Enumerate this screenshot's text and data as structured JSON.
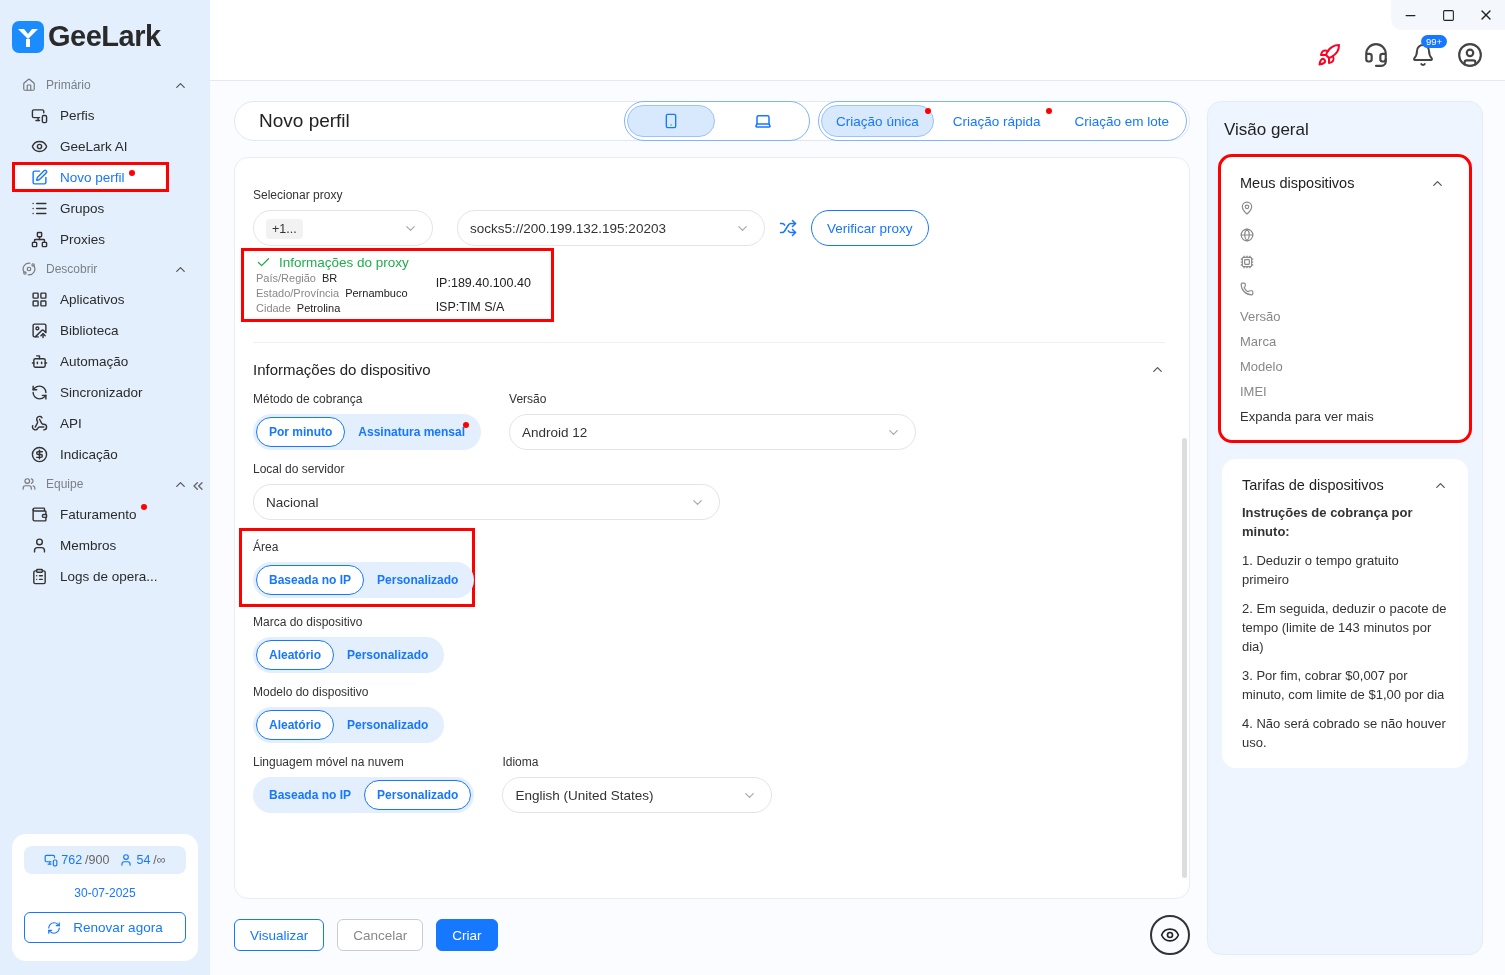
{
  "logo": {
    "text": "GeeLark"
  },
  "sidebar": {
    "sections": [
      {
        "title": "Primário",
        "kind": "home",
        "expanded": true,
        "items": [
          {
            "label": "Perfis",
            "kind": "profiles",
            "selected": false,
            "dot": false,
            "highlighted": false
          },
          {
            "label": "GeeLark AI",
            "kind": "ai",
            "selected": false,
            "dot": false,
            "highlighted": false
          },
          {
            "label": "Novo perfil",
            "kind": "new",
            "selected": true,
            "dot": true,
            "highlighted": true
          },
          {
            "label": "Grupos",
            "kind": "groups",
            "selected": false,
            "dot": false,
            "highlighted": false
          },
          {
            "label": "Proxies",
            "kind": "proxies",
            "selected": false,
            "dot": false,
            "highlighted": false
          }
        ]
      },
      {
        "title": "Descobrir",
        "kind": "discover",
        "expanded": true,
        "items": [
          {
            "label": "Aplicativos",
            "kind": "apps",
            "selected": false,
            "dot": false,
            "highlighted": false
          },
          {
            "label": "Biblioteca",
            "kind": "library",
            "selected": false,
            "dot": false,
            "highlighted": false
          },
          {
            "label": "Automação",
            "kind": "automation",
            "selected": false,
            "dot": false,
            "highlighted": false
          },
          {
            "label": "Sincronizador",
            "kind": "sync",
            "selected": false,
            "dot": false,
            "highlighted": false
          },
          {
            "label": "API",
            "kind": "api",
            "selected": false,
            "dot": false,
            "highlighted": false
          },
          {
            "label": "Indicação",
            "kind": "referral",
            "selected": false,
            "dot": false,
            "highlighted": false
          }
        ]
      },
      {
        "title": "Equipe",
        "kind": "team",
        "expanded": true,
        "items": [
          {
            "label": "Faturamento",
            "kind": "billing",
            "selected": false,
            "dot": true,
            "highlighted": false
          },
          {
            "label": "Membros",
            "kind": "members",
            "selected": false,
            "dot": false,
            "highlighted": false
          },
          {
            "label": "Logs de opera...",
            "kind": "logs",
            "selected": false,
            "dot": false,
            "highlighted": false
          }
        ]
      }
    ],
    "plan": {
      "devices_used": "762",
      "devices_total": "/900",
      "members_used": "54",
      "members_total": "/∞",
      "date": "30-07-2025",
      "renew": "Renovar agora"
    }
  },
  "header": {
    "notification_badge": "99+"
  },
  "page": {
    "title": "Novo perfil",
    "device_types": [
      {
        "kind": "phone",
        "selected": true
      },
      {
        "kind": "laptop",
        "selected": false
      }
    ],
    "creation_tabs": [
      {
        "label": "Criação única",
        "selected": true,
        "dot": true
      },
      {
        "label": "Criação rápida",
        "selected": false,
        "dot": true
      },
      {
        "label": "Criação em lote",
        "selected": false,
        "dot": false
      }
    ]
  },
  "proxy": {
    "label": "Selecionar proxy",
    "type_value": "+1...",
    "address": "socks5://200.199.132.195:20203",
    "verify": "Verificar proxy",
    "info": {
      "highlighted": true,
      "title": "Informações do proxy",
      "rows": [
        {
          "label": "País/Região",
          "value": "BR"
        },
        {
          "label": "Estado/Província",
          "value": "Pernambuco"
        },
        {
          "label": "Cidade",
          "value": "Petrolina"
        }
      ],
      "details": [
        "IP:189.40.100.40",
        "ISP:TIM S/A"
      ]
    }
  },
  "device": {
    "title": "Informações do dispositivo",
    "expanded": true,
    "billing": {
      "label": "Método de cobrança",
      "options": [
        {
          "label": "Por minuto",
          "selected": true,
          "dot": false
        },
        {
          "label": "Assinatura mensal",
          "selected": false,
          "dot": true
        }
      ]
    },
    "version": {
      "label": "Versão",
      "value": "Android 12"
    },
    "server": {
      "label": "Local do servidor",
      "value": "Nacional"
    },
    "area": {
      "label": "Área",
      "highlighted": true,
      "options": [
        {
          "label": "Baseada no IP",
          "selected": true,
          "dot": false
        },
        {
          "label": "Personalizado",
          "selected": false,
          "dot": false
        }
      ]
    },
    "brand": {
      "label": "Marca do dispositivo",
      "options": [
        {
          "label": "Aleatório",
          "selected": true,
          "dot": false
        },
        {
          "label": "Personalizado",
          "selected": false,
          "dot": false
        }
      ]
    },
    "model": {
      "label": "Modelo do dispositivo",
      "options": [
        {
          "label": "Aleatório",
          "selected": true,
          "dot": false
        },
        {
          "label": "Personalizado",
          "selected": false,
          "dot": false
        }
      ]
    },
    "language": {
      "label": "Linguagem móvel na nuvem",
      "options": [
        {
          "label": "Baseada no IP",
          "selected": false,
          "dot": false
        },
        {
          "label": "Personalizado",
          "selected": true,
          "dot": false
        }
      ]
    },
    "locale": {
      "label": "Idioma",
      "value": "English (United States)"
    }
  },
  "actions": [
    {
      "label": "Visualizar",
      "kind": "outline"
    },
    {
      "label": "Cancelar",
      "kind": "ghost"
    },
    {
      "label": "Criar",
      "kind": "primary"
    }
  ],
  "overview": {
    "title": "Visão geral",
    "my_devices": {
      "title": "Meus dispositivos",
      "expanded": true,
      "highlighted": true,
      "rows": [
        {
          "kind": "location"
        },
        {
          "kind": "timezone"
        },
        {
          "kind": "sim"
        },
        {
          "kind": "phone"
        },
        {
          "kind": "text",
          "label": "Versão"
        },
        {
          "kind": "text",
          "label": "Marca"
        },
        {
          "kind": "text",
          "label": "Modelo"
        },
        {
          "kind": "text",
          "label": "IMEI"
        }
      ],
      "more": "Expanda para ver mais"
    },
    "fees": {
      "title": "Tarifas de dispositivos",
      "expanded": true,
      "heading": "Instruções de cobrança por minuto:",
      "items": [
        "1. Deduzir o tempo gratuito primeiro",
        "2. Em seguida, deduzir o pacote de tempo (limite de 143 minutos por dia)",
        "3. Por fim, cobrar $0,007 por minuto, com limite de $1,00 por dia",
        "4. Não será cobrado se não houver uso."
      ]
    }
  }
}
